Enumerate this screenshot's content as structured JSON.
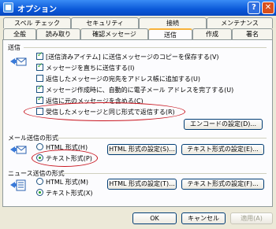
{
  "window": {
    "title": "オプション",
    "help_label": "?",
    "close_label": "✕"
  },
  "tabs_back": [
    "スペル チェック",
    "セキュリティ",
    "接続",
    "メンテナンス"
  ],
  "tabs_front": [
    "全般",
    "読み取り",
    "確認メッセージ",
    "送信",
    "作成",
    "署名"
  ],
  "active_tab": "送信",
  "sections": {
    "send": {
      "title": "送信",
      "options": [
        {
          "label": "[送信済みアイテム] に送信メッセージのコピーを保存する(V)",
          "checked": true
        },
        {
          "label": "メッセージを直ちに送信する(I)",
          "checked": true
        },
        {
          "label": "返信したメッセージの宛先をアドレス帳に追加する(U)",
          "checked": false
        },
        {
          "label": "メッセージ作成時に、自動的に電子メール アドレスを完了する(U)",
          "checked": true
        },
        {
          "label": "返信に元のメッセージを含める(C)",
          "checked": true
        },
        {
          "label": "受信したメッセージと同じ形式で返信する(R)",
          "checked": false
        }
      ],
      "encode_button": "エンコードの設定(D)..."
    },
    "mail_format": {
      "title": "メール送信の形式",
      "html_label": "HTML 形式(H)",
      "text_label": "テキスト形式(P)",
      "selected": "text",
      "html_settings_button": "HTML 形式の設定(S)...",
      "text_settings_button": "テキスト形式の設定(E)..."
    },
    "news_format": {
      "title": "ニュース送信の形式",
      "html_label": "HTML 形式(M)",
      "text_label": "テキスト形式(X)",
      "selected": "text",
      "html_settings_button": "HTML 形式の設定(T)...",
      "text_settings_button": "テキスト形式の設定(F)..."
    }
  },
  "footer": {
    "ok": "OK",
    "cancel": "キャンセル",
    "apply": "適用(A)"
  },
  "colors": {
    "annotation": "#c8141e",
    "titlebar": "#0a58d8"
  }
}
